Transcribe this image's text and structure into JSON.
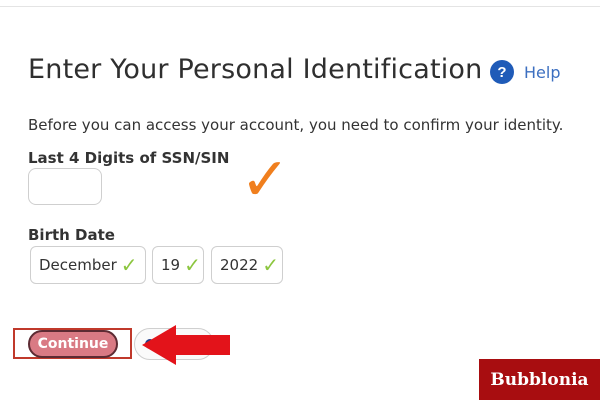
{
  "page": {
    "title": "Enter Your Personal Identification",
    "help": {
      "icon": "question-circle-icon",
      "label": "Help"
    },
    "intro": "Before you can access your account, you need to confirm your identity."
  },
  "form": {
    "ssn": {
      "label": "Last 4 Digits of SSN/SIN",
      "value": ""
    },
    "birth_date": {
      "label": "Birth Date",
      "month": "December",
      "day": "19",
      "year": "2022",
      "valid_icon": "check-mark-icon"
    },
    "continue_label": "Continue"
  },
  "annotations": {
    "checkmark": "✓",
    "checkmark_color": "#f07f1e",
    "arrow_color": "#e3131a"
  },
  "watermark": {
    "text": "Bubblonia",
    "background": "#a80d10"
  },
  "colors": {
    "accent": "#1f5bb8",
    "continue_button": "#d97a84",
    "valid_check": "#8cc63f"
  }
}
